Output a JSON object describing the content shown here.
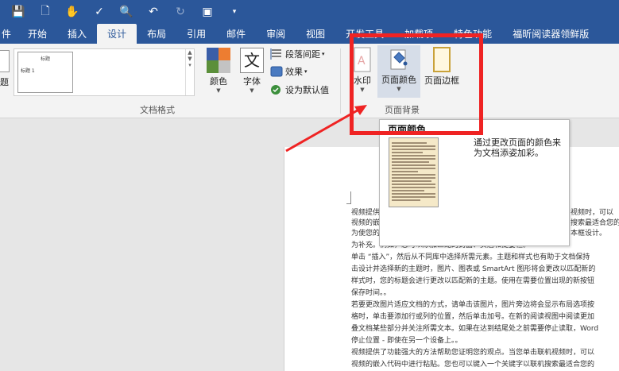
{
  "tabs": [
    "件",
    "开始",
    "插入",
    "设计",
    "布局",
    "引用",
    "邮件",
    "审阅",
    "视图",
    "开发工具",
    "加载项",
    "特色功能",
    "福昕阅读器领鲜版"
  ],
  "active_tab": "设计",
  "styles_gallery": {
    "thumb_title": "标题",
    "thumb_heading": "标题 1",
    "left_label": "题"
  },
  "buttons": {
    "colors": "颜色",
    "fonts": "字体",
    "paragraph_spacing": "段落间距",
    "effects": "效果",
    "set_default": "设为默认值",
    "watermark": "水印",
    "page_color": "页面颜色",
    "page_borders": "页面边框"
  },
  "fonts_glyph": "文",
  "groups": {
    "document_formatting": "文档格式",
    "page_background": "页面背景"
  },
  "tooltip": {
    "title": "页面颜色",
    "description": "通过更改页面的颜色来为文档添姿加彩。"
  },
  "document_lines": [
    "视频提供",
    "视频的嵌",
    "为使您的",
    "为补充。例如，您可以添加匹配的封面、页眉和提要栏。",
    "单击 “插入”，然后从不同库中选择所需元素。主题和样式也有助于文档保持",
    "击设计并选择新的主题时，图片、图表或 SmartArt 图形将会更改以匹配新的",
    "样式时，您的标题会进行更改以匹配新的主题。使用在需要位置出现的新按钮",
    "保存时间。。",
    "若要更改图片适应文档的方式，请单击该图片，图片旁边将会显示布局选项按",
    "格时，单击要添加行或列的位置，然后单击加号。在新的阅读视图中阅读更加",
    "叠文档某些部分并关注所需文本。如果在达到结尾处之前需要停止读取，Word",
    "停止位置 - 即使在另一个设备上。。",
    "视频提供了功能强大的方法帮助您证明您的观点。当您单击联机视频时，可以",
    "视频的嵌入代码中进行粘贴。您也可以键入一个关键字以联机搜索最适合您的"
  ],
  "document_right_fragments": [
    "视频时，可以",
    "搜索最适合您的",
    "本框设计。"
  ],
  "colors": {
    "ribbon_blue": "#2b579a",
    "highlight_red": "#ef2323",
    "page_color_btn": "#d6dde8"
  }
}
